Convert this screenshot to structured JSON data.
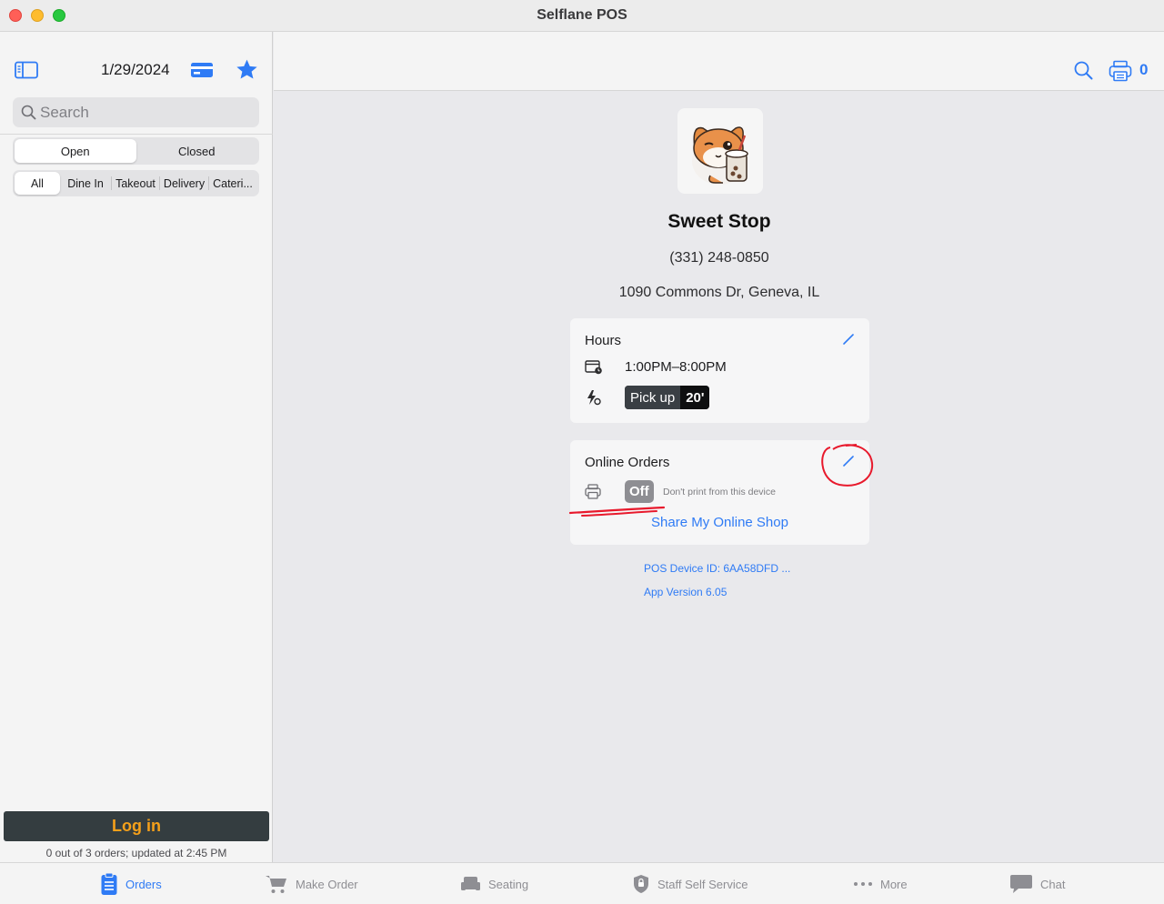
{
  "window": {
    "title": "Selflane POS"
  },
  "sidebar": {
    "date": "1/29/2024",
    "search_placeholder": "Search",
    "state_tabs": [
      "Open",
      "Closed"
    ],
    "type_tabs": [
      "All",
      "Dine In",
      "Takeout",
      "Delivery",
      "Cateri..."
    ],
    "login_label": "Log in",
    "status": "0 out of 3 orders; updated at 2:45 PM"
  },
  "topbar": {
    "printer_count": "0"
  },
  "store": {
    "name": "Sweet Stop",
    "phone": "(331) 248-0850",
    "address": "1090 Commons Dr, Geneva, IL"
  },
  "hours": {
    "title": "Hours",
    "time": "1:00PM–8:00PM",
    "pickup_label": "Pick up",
    "pickup_minutes": "20'"
  },
  "online_orders": {
    "title": "Online Orders",
    "print_state": "Off",
    "print_note": "Don't print from this device",
    "share_link": "Share My Online Shop"
  },
  "device": {
    "id_text": "POS Device ID: 6AA58DFD ...",
    "version_text": "App Version 6.05"
  },
  "tabs": [
    {
      "label": "Orders",
      "icon": "clipboard-icon"
    },
    {
      "label": "Make Order",
      "icon": "cart-icon"
    },
    {
      "label": "Seating",
      "icon": "sofa-icon"
    },
    {
      "label": "Staff Self Service",
      "icon": "shield-icon"
    },
    {
      "label": "More",
      "icon": "ellipsis-icon"
    },
    {
      "label": "Chat",
      "icon": "chat-bubble-icon"
    }
  ],
  "colors": {
    "accent": "#2f7bf5",
    "login_bg": "#343d40",
    "login_text": "#f5a01a",
    "annotation": "#e8192c"
  }
}
